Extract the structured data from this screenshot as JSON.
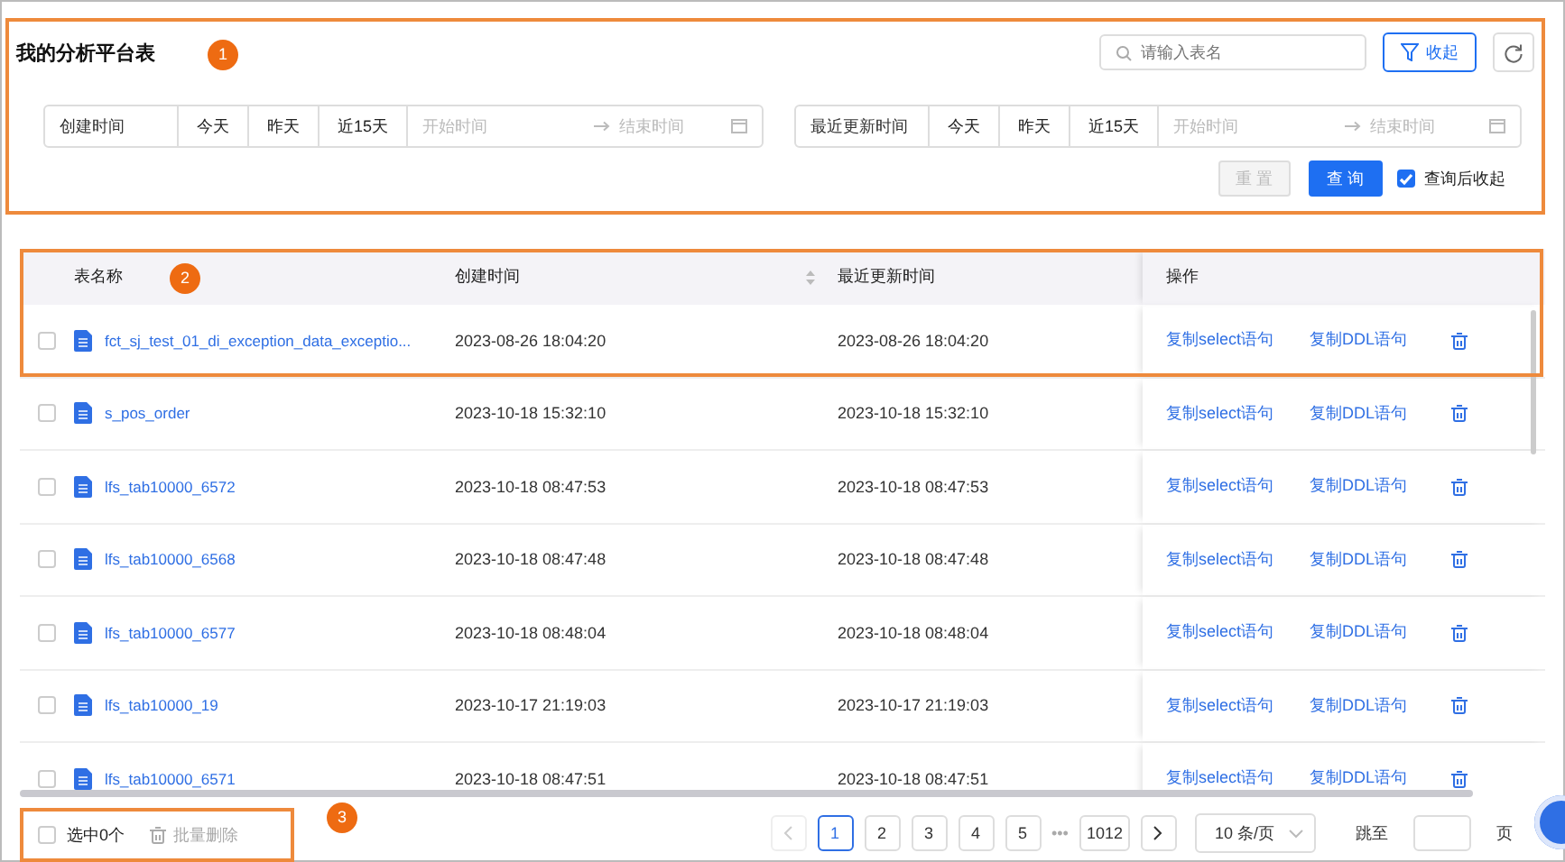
{
  "panel": {
    "title": "我的分析平台表",
    "callout": "1",
    "search": {
      "placeholder": "请输入表名"
    },
    "collapse_button": "收起",
    "filters": [
      {
        "label": "创建时间",
        "quick": [
          "今天",
          "昨天",
          "近15天"
        ],
        "start_placeholder": "开始时间",
        "end_placeholder": "结束时间"
      },
      {
        "label": "最近更新时间",
        "quick": [
          "今天",
          "昨天",
          "近15天"
        ],
        "start_placeholder": "开始时间",
        "end_placeholder": "结束时间"
      }
    ],
    "reset_button": "重 置",
    "query_button": "查 询",
    "collapse_after_query": {
      "label": "查询后收起",
      "checked": true
    }
  },
  "table": {
    "callout": "2",
    "columns": [
      "表名称",
      "创建时间",
      "最近更新时间",
      "操作"
    ],
    "rows": [
      {
        "checked": false,
        "name": "fct_sj_test_01_di_exception_data_exceptio...",
        "created": "2023-08-26 18:04:20",
        "updated": "2023-08-26 18:04:20",
        "actions": [
          "复制select语句",
          "复制DDL语句"
        ]
      },
      {
        "checked": false,
        "name": "s_pos_order",
        "created": "2023-10-18 15:32:10",
        "updated": "2023-10-18 15:32:10",
        "actions": [
          "复制select语句",
          "复制DDL语句"
        ]
      },
      {
        "checked": false,
        "name": "lfs_tab10000_6572",
        "created": "2023-10-18 08:47:53",
        "updated": "2023-10-18 08:47:53",
        "actions": [
          "复制select语句",
          "复制DDL语句"
        ]
      },
      {
        "checked": false,
        "name": "lfs_tab10000_6568",
        "created": "2023-10-18 08:47:48",
        "updated": "2023-10-18 08:47:48",
        "actions": [
          "复制select语句",
          "复制DDL语句"
        ]
      },
      {
        "checked": false,
        "name": "lfs_tab10000_6577",
        "created": "2023-10-18 08:48:04",
        "updated": "2023-10-18 08:48:04",
        "actions": [
          "复制select语句",
          "复制DDL语句"
        ]
      },
      {
        "checked": false,
        "name": "lfs_tab10000_19",
        "created": "2023-10-17 21:19:03",
        "updated": "2023-10-17 21:19:03",
        "actions": [
          "复制select语句",
          "复制DDL语句"
        ]
      },
      {
        "checked": false,
        "name": "lfs_tab10000_6571",
        "created": "2023-10-18 08:47:51",
        "updated": "2023-10-18 08:47:51",
        "actions": [
          "复制select语句",
          "复制DDL语句"
        ]
      }
    ]
  },
  "footer": {
    "callout": "3",
    "select_all_checked": false,
    "selected_count": "选中0个",
    "bulk_delete": "批量删除",
    "pages": [
      {
        "label": "1",
        "selected": true
      },
      {
        "label": "2",
        "selected": false
      },
      {
        "label": "3",
        "selected": false
      },
      {
        "label": "4",
        "selected": false
      },
      {
        "label": "5",
        "selected": false
      },
      {
        "label": "•••",
        "kind": "ellipsis"
      },
      {
        "label": "1012",
        "selected": false
      }
    ],
    "per_page": "10 条/页",
    "jump_label": "跳至",
    "page_unit": "页"
  }
}
